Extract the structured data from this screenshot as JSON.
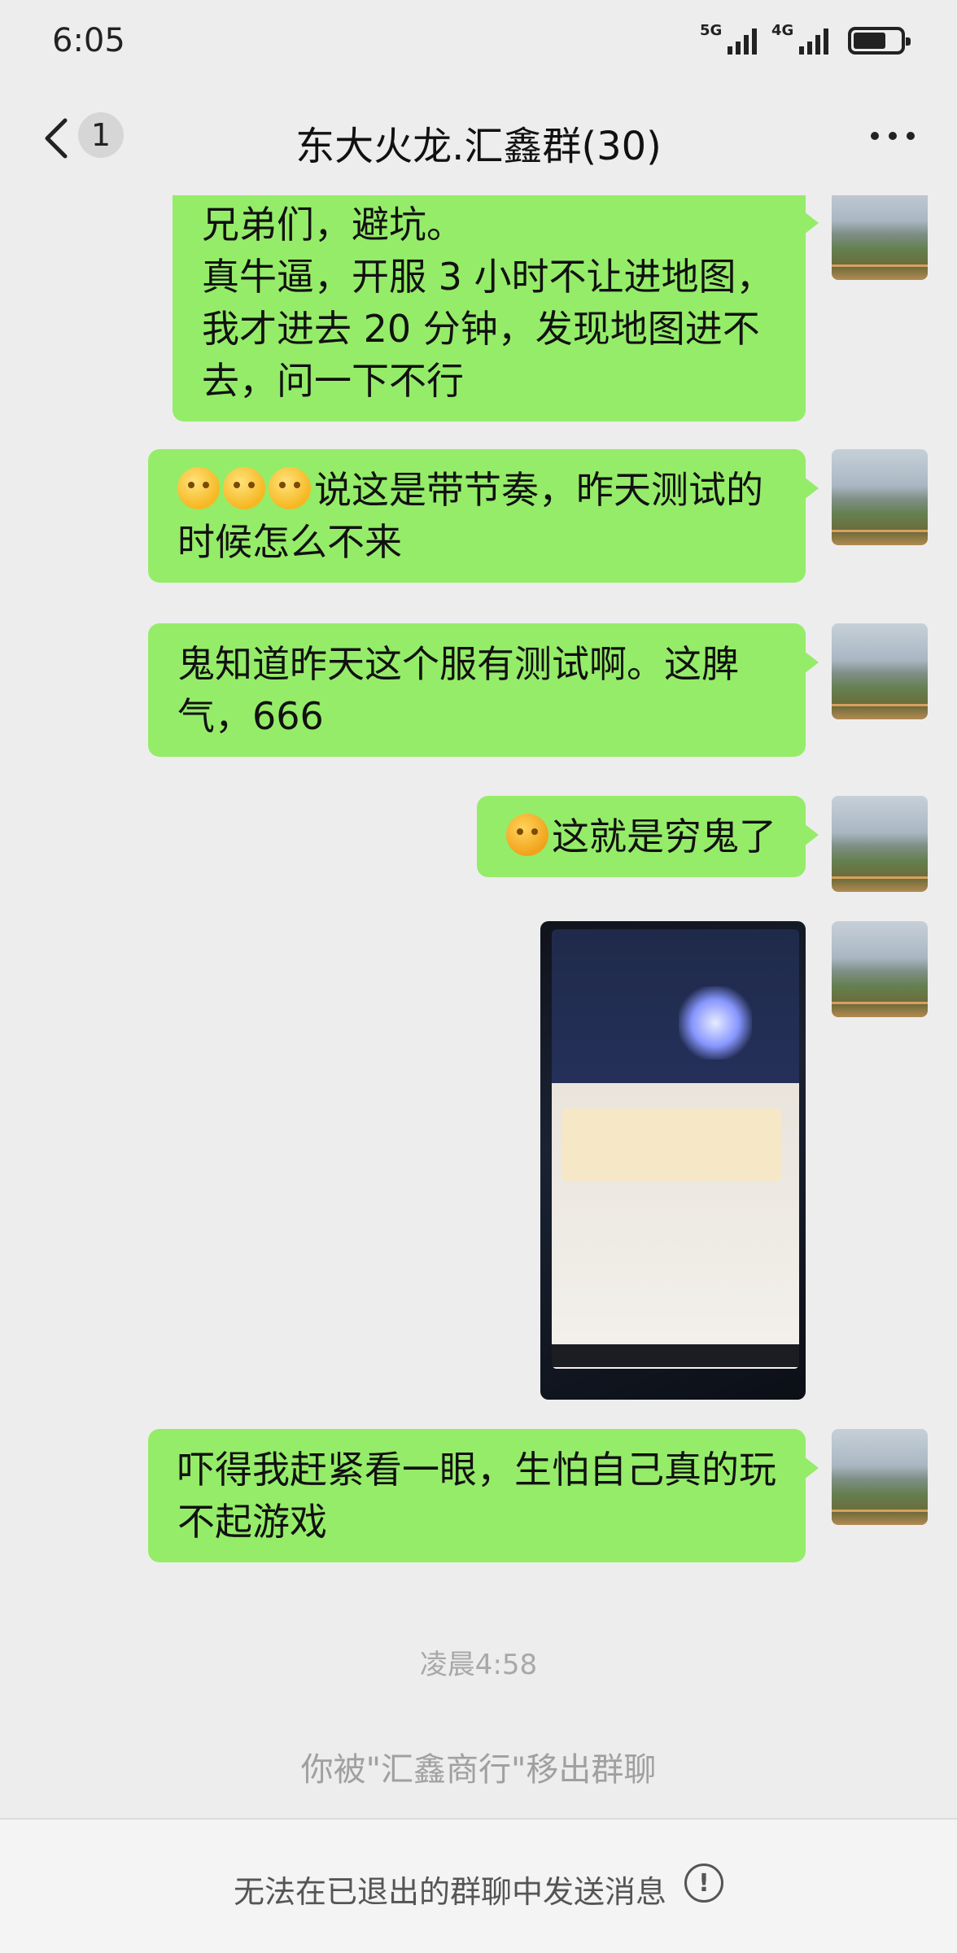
{
  "status_bar": {
    "time": "6:05",
    "net1": "5G",
    "net2": "4G"
  },
  "header": {
    "unread_count": "1",
    "title": "东大火龙.汇鑫群(30)"
  },
  "messages": [
    {
      "text": "兄弟们，避坑。\n真牛逼，开服 3 小时不让进地图，我才进去 20 分钟，发现地图进不去，问一下不行"
    },
    {
      "text": "说这是带节奏，昨天测试的时候怎么不来",
      "emoji": [
        "thinking-emoji",
        "thinking-emoji",
        "thinking-emoji"
      ]
    },
    {
      "text": "鬼知道昨天这个服有测试啊。这脾气，666"
    },
    {
      "text": "这就是穷鬼了",
      "emoji": [
        "crying-laughing-emoji"
      ]
    },
    {
      "image": "game-vip-screenshot"
    },
    {
      "text": "吓得我赶紧看一眼，生怕自己真的玩不起游戏"
    }
  ],
  "timestamp": "凌晨4:58",
  "system_notice": "你被\"汇鑫商行\"移出群聊",
  "footer": {
    "text": "无法在已退出的群聊中发送消息",
    "icon": "exclamation-circle-icon"
  }
}
